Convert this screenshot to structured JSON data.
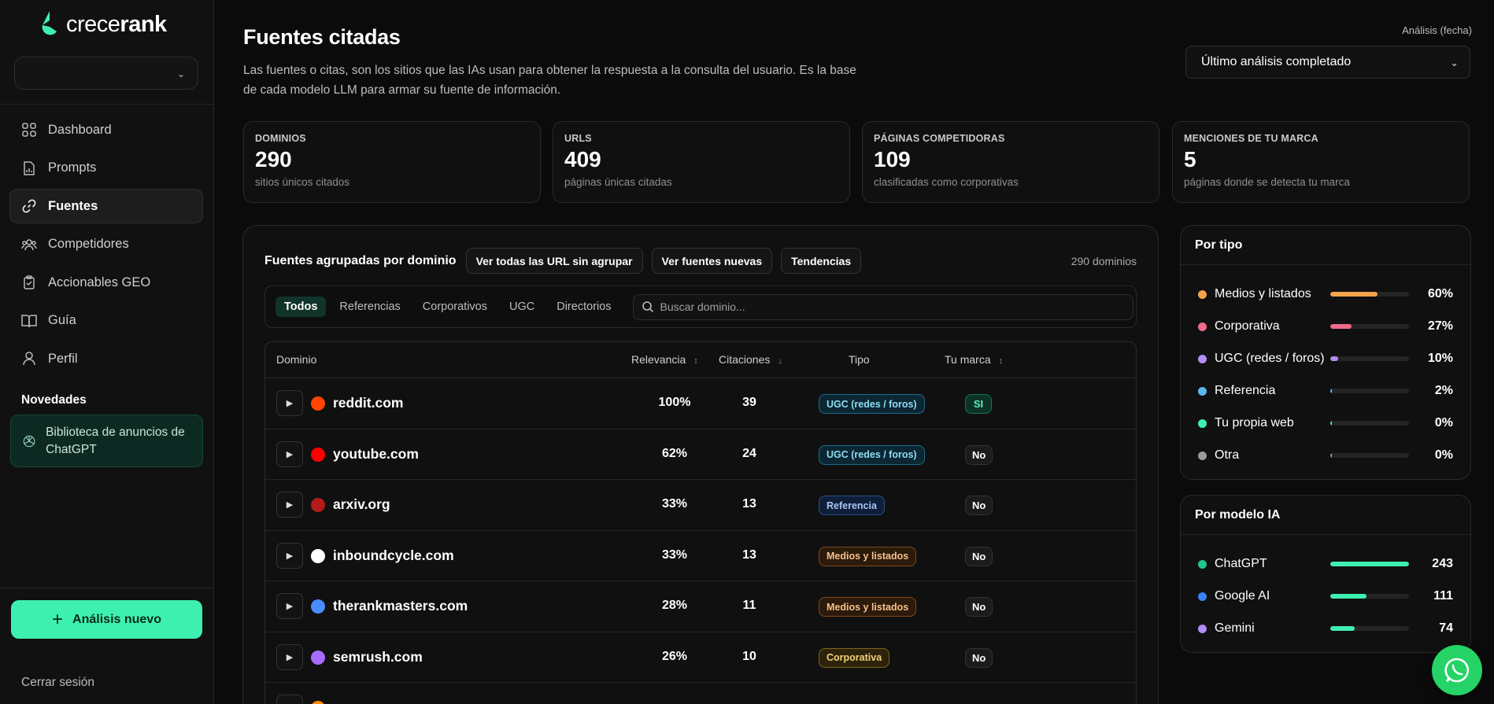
{
  "brand": {
    "name_prefix": "crece",
    "name_suffix": "rank",
    "accent": "#3ef0b0"
  },
  "sidebar": {
    "nav": [
      {
        "label": "Dashboard",
        "icon": "grid-icon"
      },
      {
        "label": "Prompts",
        "icon": "file-chart-icon"
      },
      {
        "label": "Fuentes",
        "icon": "link-icon",
        "active": true
      },
      {
        "label": "Competidores",
        "icon": "users-icon"
      },
      {
        "label": "Accionables GEO",
        "icon": "clipboard-check-icon"
      },
      {
        "label": "Guía",
        "icon": "book-icon"
      },
      {
        "label": "Perfil",
        "icon": "user-icon"
      }
    ],
    "novedades_title": "Novedades",
    "novedad": {
      "label": "Biblioteca de anuncios de ChatGPT",
      "icon": "openai-icon"
    },
    "new_analysis": "Análisis nuevo",
    "logout": "Cerrar sesión"
  },
  "header": {
    "title": "Fuentes citadas",
    "description": "Las fuentes o citas, son los sitios que las IAs usan para obtener la respuesta a la consulta del usuario. Es la base de cada modelo LLM para armar su fuente de información.",
    "date_label": "Análisis (fecha)",
    "date_value": "Último análisis completado"
  },
  "stats": [
    {
      "label": "DOMINIOS",
      "value": "290",
      "sub": "sitios únicos citados"
    },
    {
      "label": "URLS",
      "value": "409",
      "sub": "páginas únicas citadas"
    },
    {
      "label": "PÁGINAS COMPETIDORAS",
      "value": "109",
      "sub": "clasificadas como corporativas"
    },
    {
      "label": "MENCIONES DE TU MARCA",
      "value": "5",
      "sub": "páginas donde se detecta tu marca"
    }
  ],
  "main": {
    "title": "Fuentes agrupadas por dominio",
    "buttons": [
      "Ver todas las URL sin agrupar",
      "Ver fuentes nuevas",
      "Tendencias"
    ],
    "count": "290 dominios",
    "filters": [
      "Todos",
      "Referencias",
      "Corporativos",
      "UGC",
      "Directorios"
    ],
    "search_placeholder": "Buscar dominio...",
    "columns": {
      "domain": "Dominio",
      "relevance": "Relevancia",
      "citations": "Citaciones",
      "type": "Tipo",
      "brand": "Tu marca"
    },
    "rows": [
      {
        "domain": "reddit.com",
        "relevance": "100%",
        "citations": "39",
        "type": "UGC (redes / foros)",
        "type_class": "b-ugc",
        "brand": "SI",
        "brand_class": "si",
        "favicon": "#ff4500"
      },
      {
        "domain": "youtube.com",
        "relevance": "62%",
        "citations": "24",
        "type": "UGC (redes / foros)",
        "type_class": "b-ugc",
        "brand": "No",
        "brand_class": "no",
        "favicon": "#ff0000"
      },
      {
        "domain": "arxiv.org",
        "relevance": "33%",
        "citations": "13",
        "type": "Referencia",
        "type_class": "b-ref",
        "brand": "No",
        "brand_class": "no",
        "favicon": "#b31b1b"
      },
      {
        "domain": "inboundcycle.com",
        "relevance": "33%",
        "citations": "13",
        "type": "Medios y listados",
        "type_class": "b-med",
        "brand": "No",
        "brand_class": "no",
        "favicon": "#ffffff"
      },
      {
        "domain": "therankmasters.com",
        "relevance": "28%",
        "citations": "11",
        "type": "Medios y listados",
        "type_class": "b-med",
        "brand": "No",
        "brand_class": "no",
        "favicon": "#4a8cff"
      },
      {
        "domain": "semrush.com",
        "relevance": "26%",
        "citations": "10",
        "type": "Corporativa",
        "type_class": "b-corp",
        "brand": "No",
        "brand_class": "no",
        "favicon": "#a66cff"
      },
      {
        "domain": "",
        "relevance": "",
        "citations": "",
        "type": "",
        "type_class": "b-corp",
        "brand": "",
        "brand_class": "no",
        "favicon": "#ff8a00"
      }
    ]
  },
  "por_tipo": {
    "title": "Por tipo",
    "items": [
      {
        "label": "Medios y listados",
        "value": "60%",
        "fraction": 0.6,
        "color": "#f5a24a"
      },
      {
        "label": "Corporativa",
        "value": "27%",
        "fraction": 0.27,
        "color": "#f06a8a"
      },
      {
        "label": "UGC (redes / foros)",
        "value": "10%",
        "fraction": 0.1,
        "color": "#b38cf5"
      },
      {
        "label": "Referencia",
        "value": "2%",
        "fraction": 0.02,
        "color": "#5ab8f0"
      },
      {
        "label": "Tu propia web",
        "value": "0%",
        "fraction": 0.0,
        "color": "#3ef0b0"
      },
      {
        "label": "Otra",
        "value": "0%",
        "fraction": 0.0,
        "color": "#9a9a9a"
      }
    ]
  },
  "por_modelo": {
    "title": "Por modelo IA",
    "items": [
      {
        "label": "ChatGPT",
        "value": "243",
        "fraction": 1.0,
        "color": "#22c58b",
        "bar_color": "#3ef0b0"
      },
      {
        "label": "Google AI",
        "value": "111",
        "fraction": 0.457,
        "color": "#3b82f6",
        "bar_color": "#3ef0b0"
      },
      {
        "label": "Gemini",
        "value": "74",
        "fraction": 0.305,
        "color": "#b38cf5",
        "bar_color": "#3ef0b0"
      }
    ]
  }
}
